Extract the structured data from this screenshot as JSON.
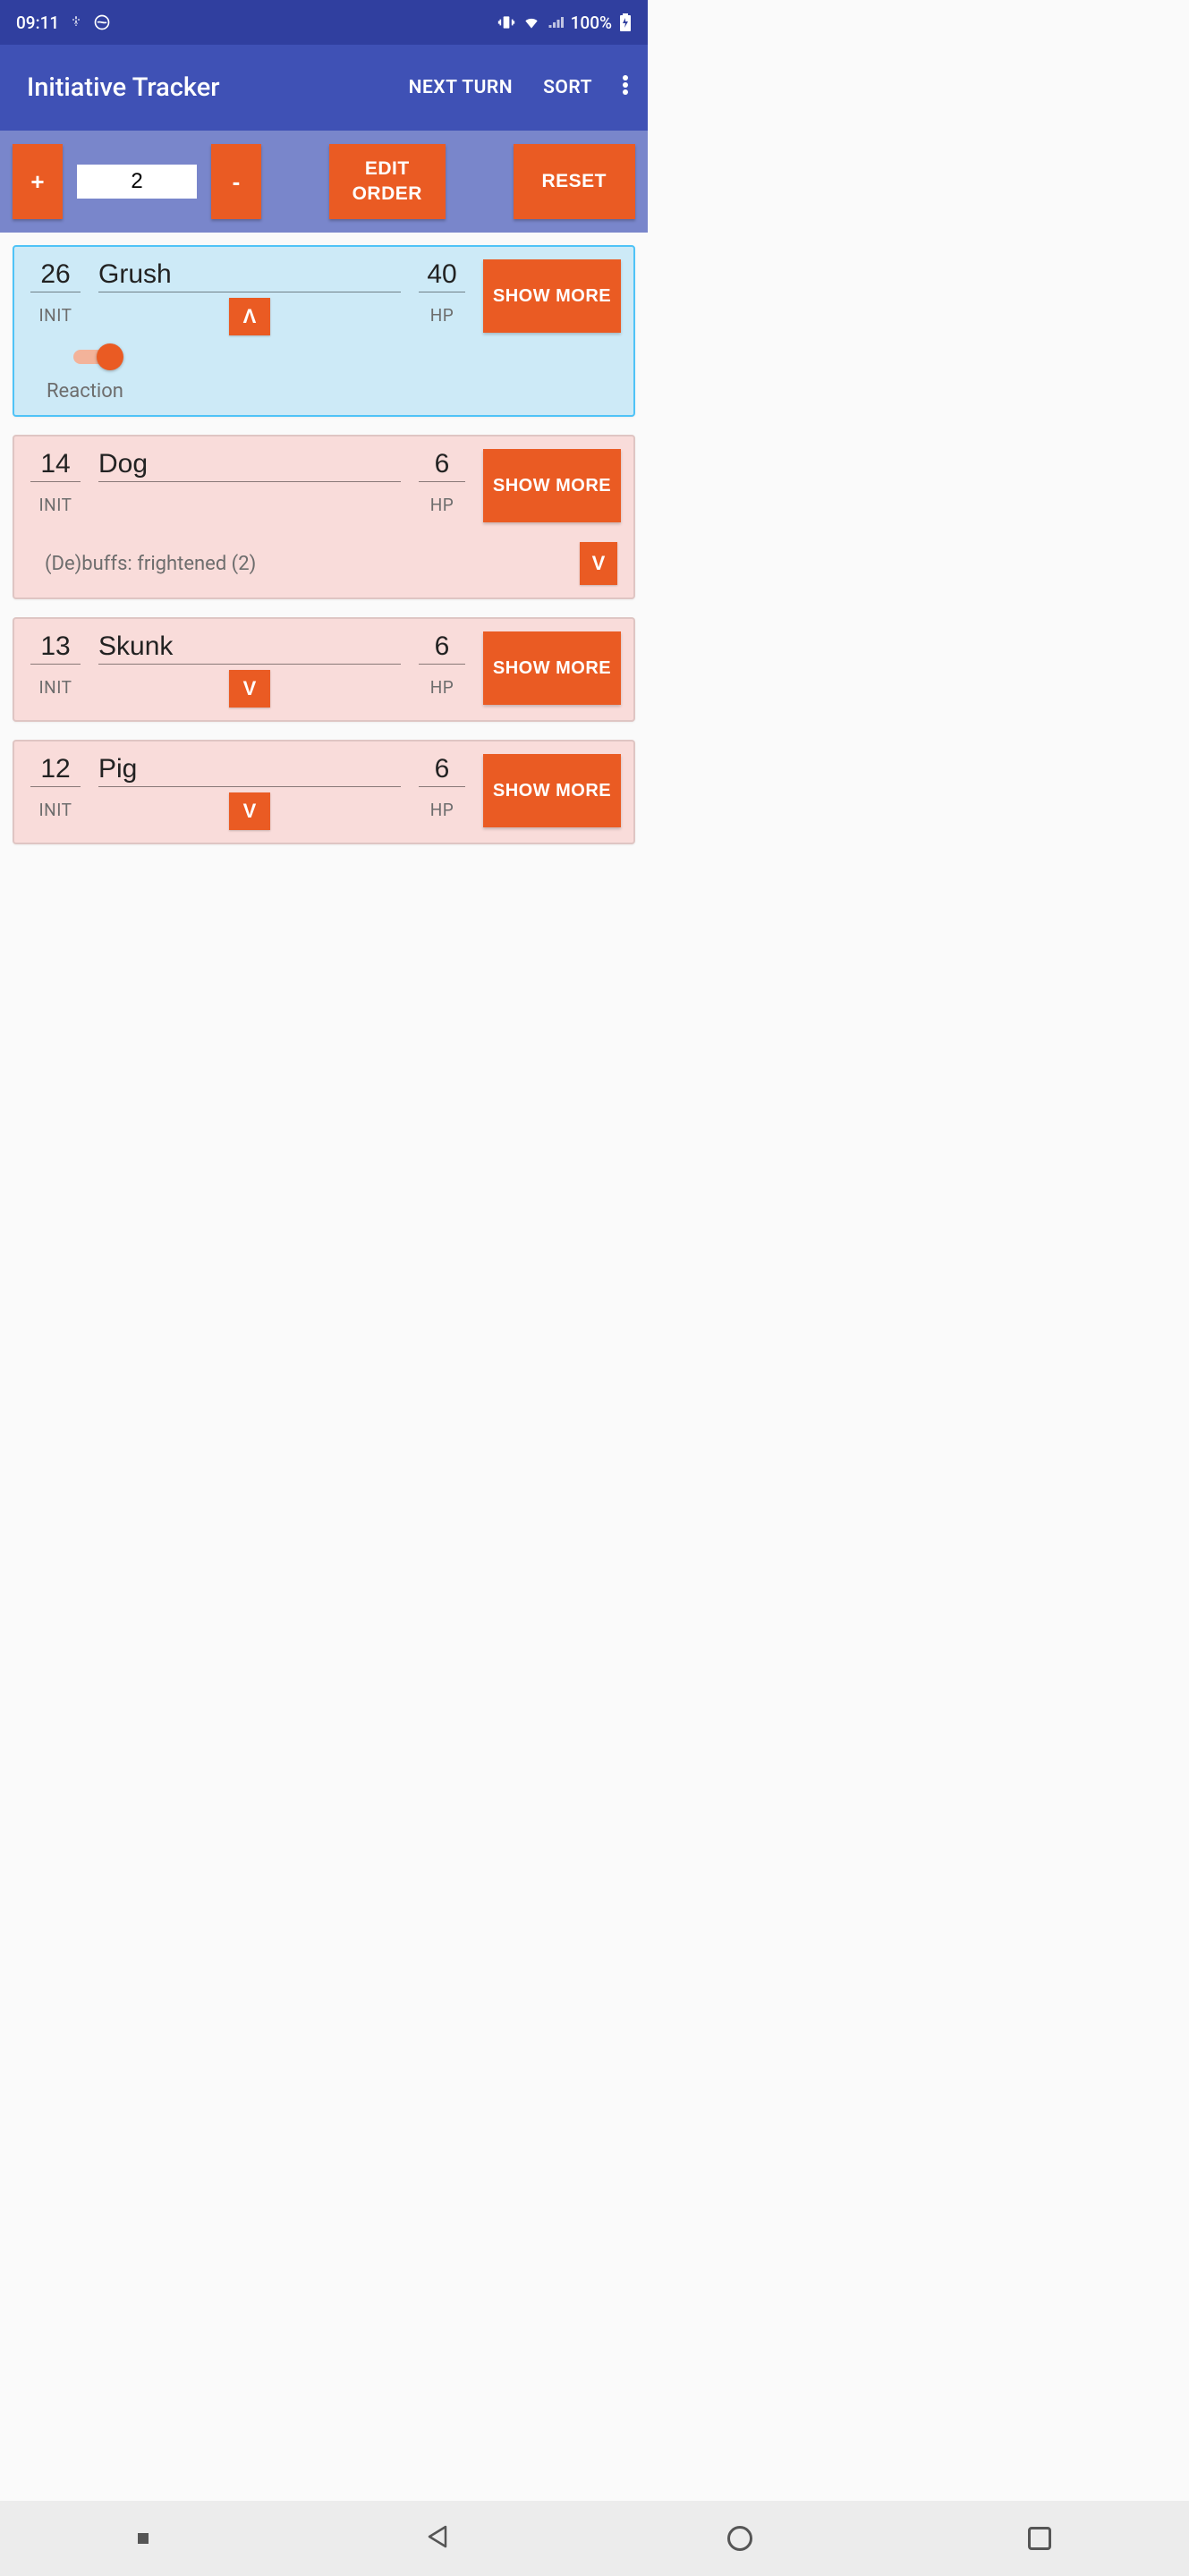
{
  "status": {
    "time": "09:11",
    "battery": "100%"
  },
  "appbar": {
    "title": "Initiative Tracker",
    "next_turn": "NEXT TURN",
    "sort": "SORT"
  },
  "toolbar": {
    "plus": "+",
    "minus": "-",
    "count": "2",
    "edit_order": "EDIT\nORDER",
    "reset": "RESET"
  },
  "labels": {
    "init": "INIT",
    "hp": "HP",
    "show_more": "SHOW\nMORE",
    "reaction": "Reaction",
    "up": "Λ",
    "down": "V"
  },
  "cards": [
    {
      "init": "26",
      "name": "Grush",
      "hp": "40",
      "active": true,
      "reaction": true,
      "chev": "up",
      "debuffs": null
    },
    {
      "init": "14",
      "name": "Dog",
      "hp": "6",
      "active": false,
      "reaction": false,
      "chev": null,
      "debuffs": "(De)buffs: frightened (2)"
    },
    {
      "init": "13",
      "name": "Skunk",
      "hp": "6",
      "active": false,
      "reaction": false,
      "chev": "down",
      "debuffs": null
    },
    {
      "init": "12",
      "name": "Pig",
      "hp": "6",
      "active": false,
      "reaction": false,
      "chev": "down",
      "debuffs": null
    }
  ]
}
